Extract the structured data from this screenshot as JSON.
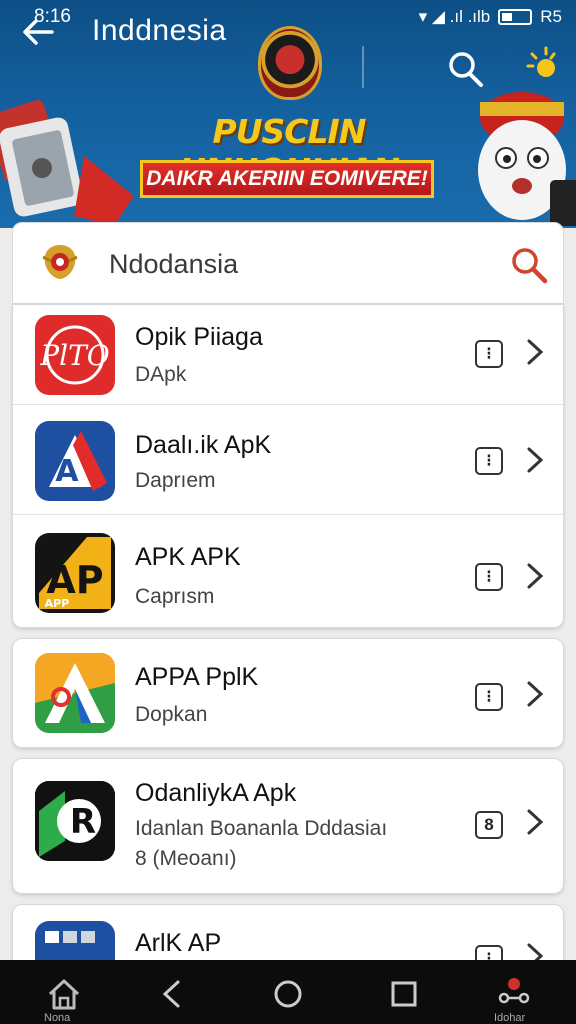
{
  "status_bar": {
    "time": "8:16",
    "network": "▾ ◢ .ıl .ılb",
    "battery_label": "R5"
  },
  "header": {
    "title": "Inddnesia",
    "banner_headline": "PUSCLIN UNUOUHIAN",
    "banner_ribbon": "DAIKR AKERIIN EOMIVERE!"
  },
  "search": {
    "value": "Ndodansia"
  },
  "apps": [
    {
      "name": "Opik Piiaga",
      "subtitle": "DApk",
      "subtitle2": "",
      "badge": "",
      "icon_label": "PlTO",
      "accent": "#e02b2b"
    },
    {
      "name": "Daalı.ik ApK",
      "subtitle": "Daprıem",
      "subtitle2": "",
      "badge": "",
      "icon_label": "A",
      "accent": "#1e4fa0"
    },
    {
      "name": "APK APK",
      "subtitle": "Caprısm",
      "subtitle2": "",
      "badge": "",
      "icon_label": "AP",
      "icon_small": "APP",
      "accent": "#f3b118"
    },
    {
      "name": "APPA PplK",
      "subtitle": "Dopkan",
      "subtitle2": "",
      "badge": "",
      "icon_label": "A",
      "accent": "#f5a623"
    },
    {
      "name": "OdanliykA Apk",
      "subtitle": "Idanlan Boananla Dddasiaı",
      "subtitle2": "8 (Meoanı)",
      "badge": "8",
      "icon_label": "R",
      "accent": "#1aa04a"
    },
    {
      "name": "ArlK AP",
      "subtitle": "",
      "subtitle2": "",
      "badge": "",
      "icon_label": "",
      "accent": "#1e4fa0"
    }
  ],
  "bottom_nav": {
    "home_label": "Nona",
    "right_label": "Idohar"
  },
  "colors": {
    "header_bg": "#14609e",
    "search_icon": "#d0452b",
    "nav_bg": "#0c0c0c"
  }
}
